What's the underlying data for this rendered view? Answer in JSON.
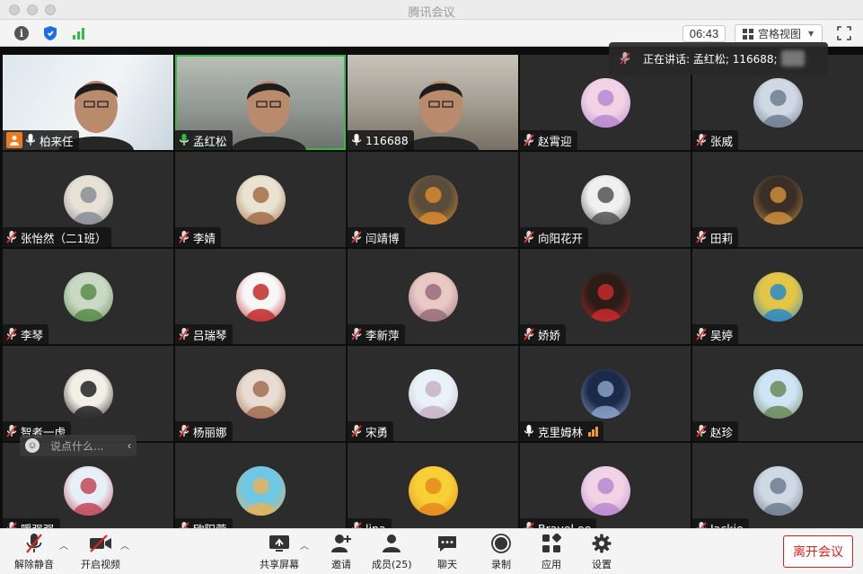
{
  "window": {
    "title": "腾讯会议"
  },
  "topbar": {
    "time": "06:43",
    "view_label": "宫格视图"
  },
  "toast": {
    "text": "正在讲话: 孟红松; 116688;"
  },
  "chat": {
    "placeholder": "说点什么..."
  },
  "participants": [
    {
      "name": "柏来任",
      "mic": "on",
      "video": true,
      "host": true
    },
    {
      "name": "孟红松",
      "mic": "on",
      "video": true,
      "speaking": true
    },
    {
      "name": "116688",
      "mic": "on",
      "video": true
    },
    {
      "name": "赵霄迎",
      "mic": "muted"
    },
    {
      "name": "张威",
      "mic": "muted"
    },
    {
      "name": "张怡然（二1班）",
      "mic": "muted"
    },
    {
      "name": "李婧",
      "mic": "muted"
    },
    {
      "name": "闫靖博",
      "mic": "muted"
    },
    {
      "name": "向阳花开",
      "mic": "muted"
    },
    {
      "name": "田莉",
      "mic": "muted"
    },
    {
      "name": "李琴",
      "mic": "muted"
    },
    {
      "name": "吕瑞琴",
      "mic": "muted"
    },
    {
      "name": "李新萍",
      "mic": "muted"
    },
    {
      "name": "娇娇",
      "mic": "muted"
    },
    {
      "name": "吴婷",
      "mic": "muted"
    },
    {
      "name": "智者一虑",
      "mic": "muted"
    },
    {
      "name": "杨丽娜",
      "mic": "muted"
    },
    {
      "name": "宋勇",
      "mic": "muted"
    },
    {
      "name": "克里姆林",
      "mic": "on",
      "signal": true
    },
    {
      "name": "赵珍",
      "mic": "muted"
    },
    {
      "name": "暖强强",
      "mic": "muted"
    },
    {
      "name": "欧阳蓉",
      "mic": "muted"
    },
    {
      "name": "lina",
      "mic": "muted"
    },
    {
      "name": "Bravel.ee",
      "mic": "muted"
    },
    {
      "name": "Jackie",
      "mic": "muted"
    }
  ],
  "bottombar": {
    "unmute": "解除静音",
    "video": "开启视频",
    "share": "共享屏幕",
    "invite": "邀请",
    "members": "成员(25)",
    "chat": "聊天",
    "record": "录制",
    "apps": "应用",
    "settings": "设置",
    "leave": "离开会议"
  },
  "colors": {
    "accent_green": "#2fbf45",
    "leave_red": "#e02020",
    "host_orange": "#f07a1a"
  }
}
